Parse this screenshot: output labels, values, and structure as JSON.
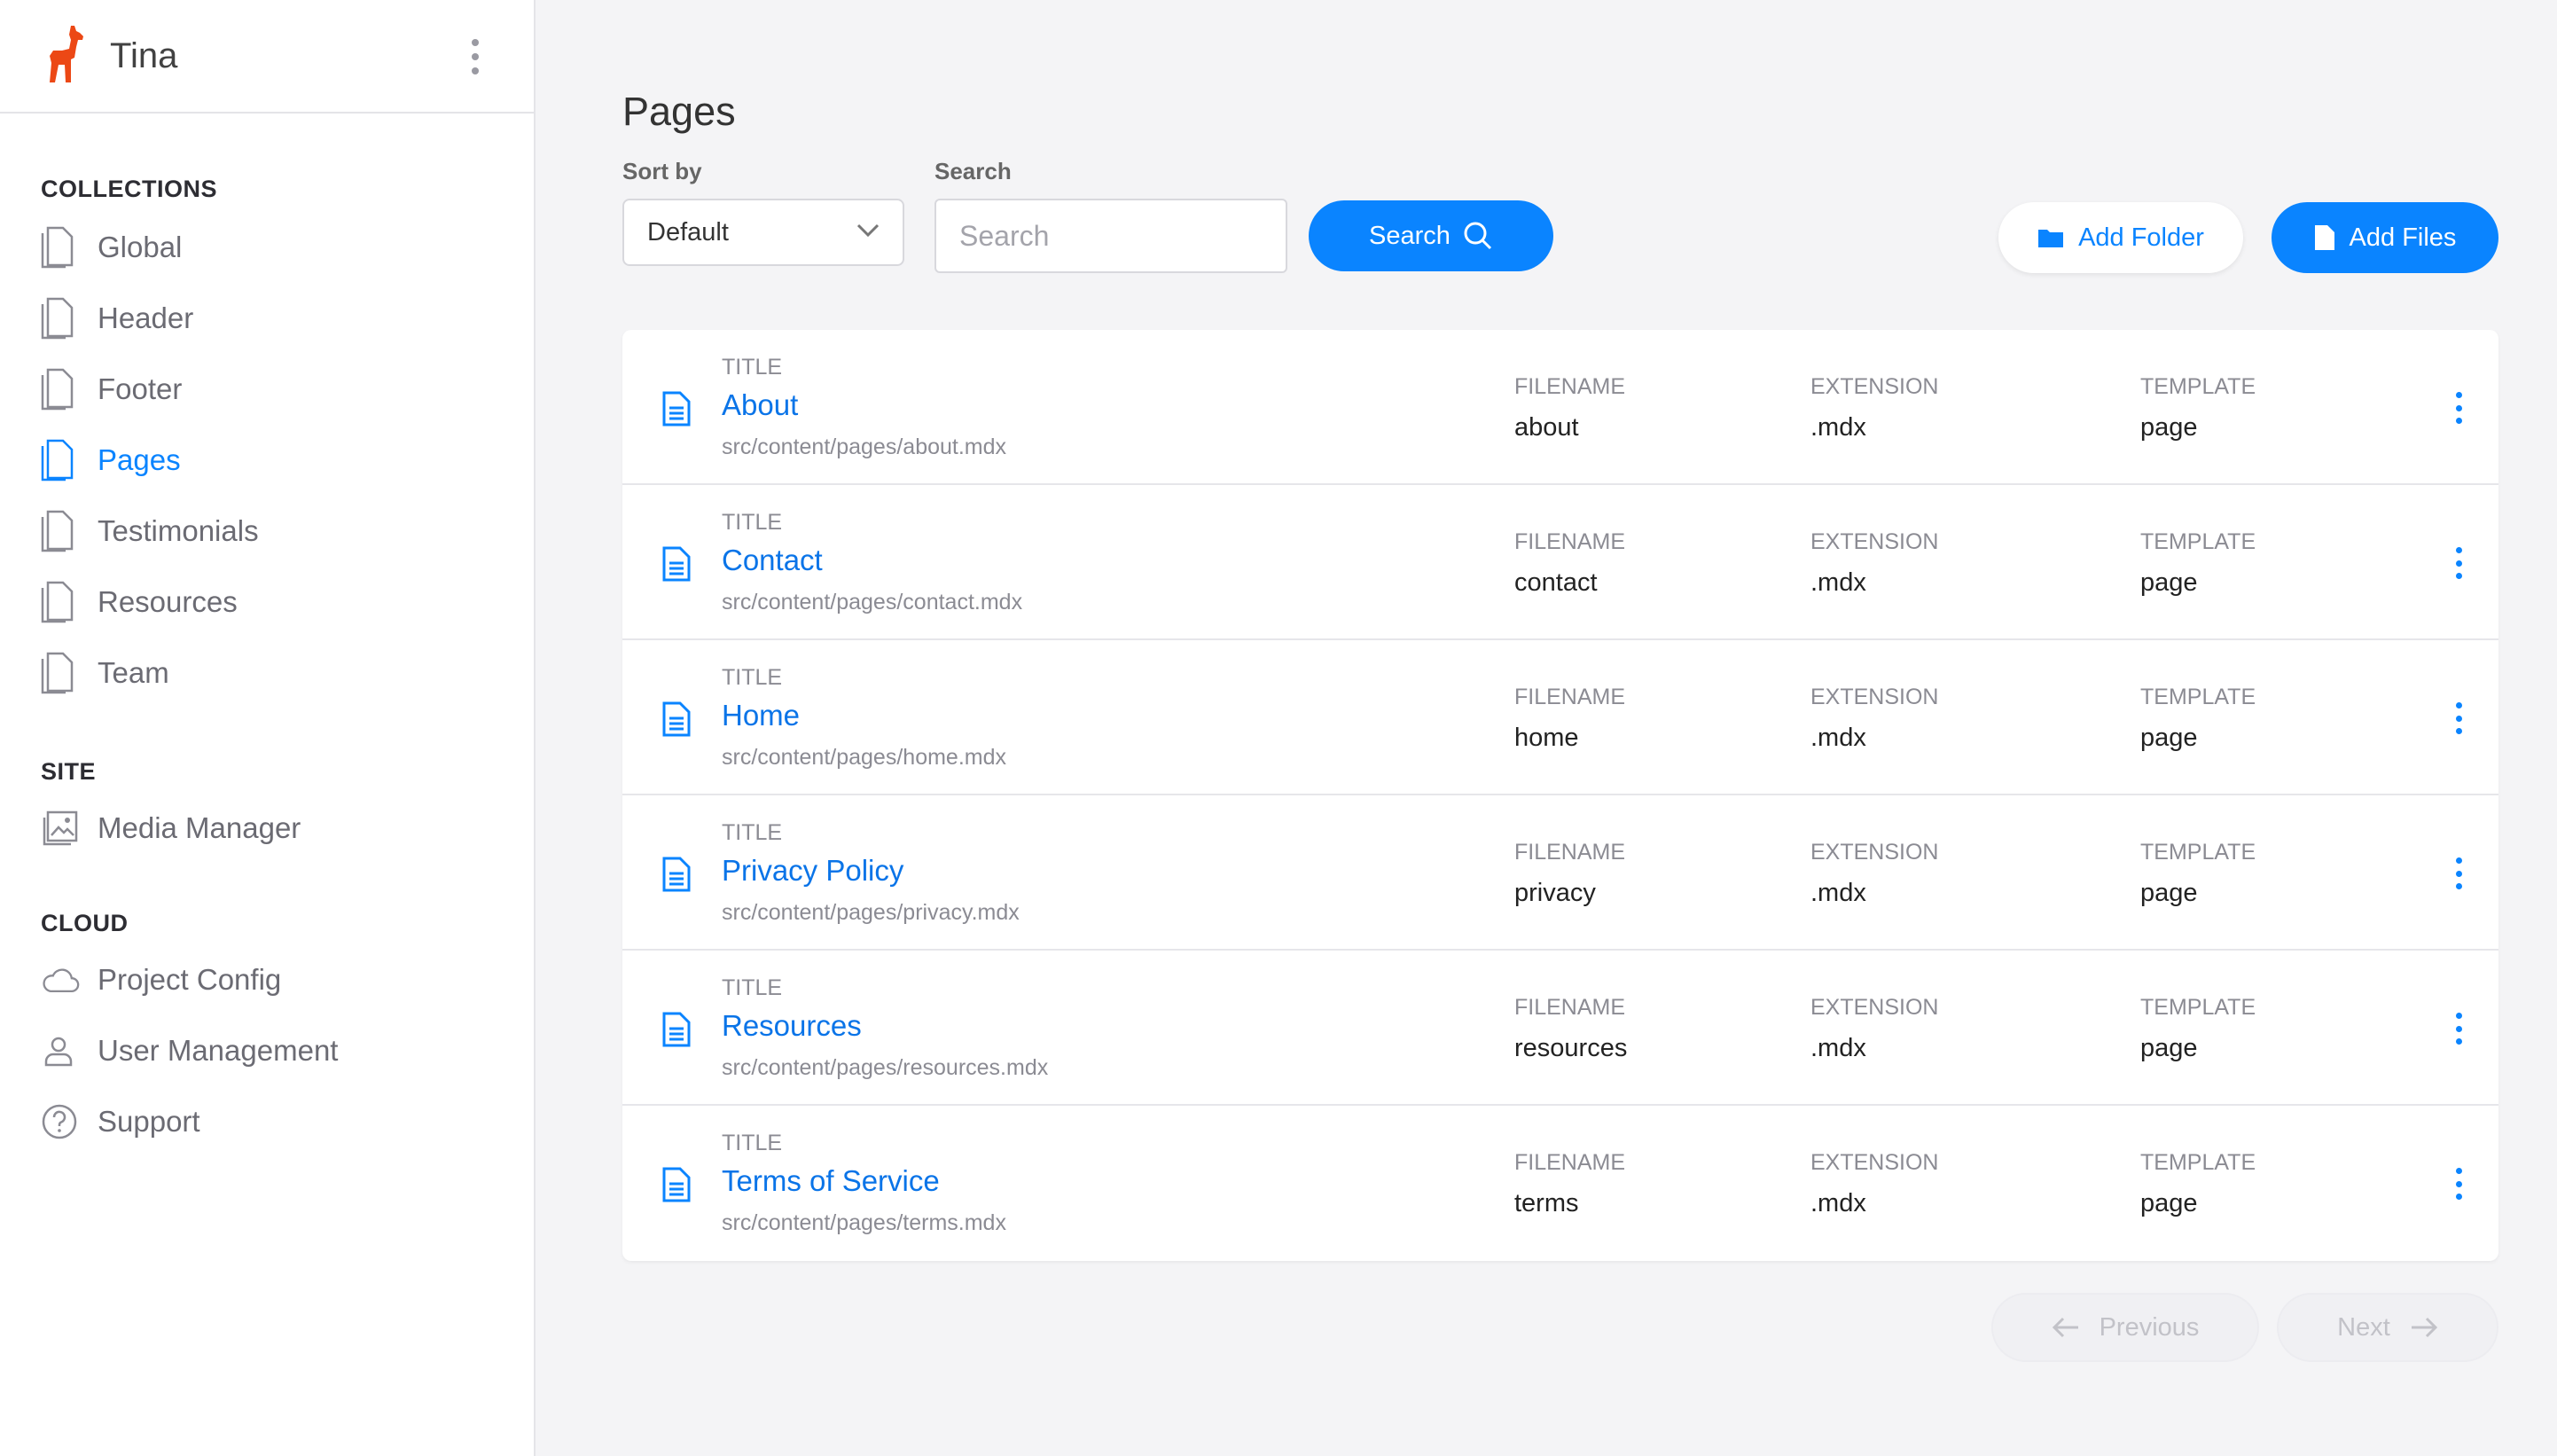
{
  "app": {
    "title": "Tina"
  },
  "sidebar": {
    "collections_label": "COLLECTIONS",
    "collections": [
      {
        "label": "Global",
        "active": false
      },
      {
        "label": "Header",
        "active": false
      },
      {
        "label": "Footer",
        "active": false
      },
      {
        "label": "Pages",
        "active": true
      },
      {
        "label": "Testimonials",
        "active": false
      },
      {
        "label": "Resources",
        "active": false
      },
      {
        "label": "Team",
        "active": false
      }
    ],
    "site_label": "SITE",
    "site": [
      {
        "label": "Media Manager",
        "icon": "image-icon"
      }
    ],
    "cloud_label": "CLOUD",
    "cloud": [
      {
        "label": "Project Config",
        "icon": "cloud-icon"
      },
      {
        "label": "User Management",
        "icon": "user-icon"
      },
      {
        "label": "Support",
        "icon": "help-icon"
      }
    ]
  },
  "main": {
    "page_title": "Pages",
    "sort_label": "Sort by",
    "sort_value": "Default",
    "search_label": "Search",
    "search_placeholder": "Search",
    "search_button": "Search",
    "add_folder": "Add Folder",
    "add_files": "Add Files",
    "columns": {
      "title": "TITLE",
      "filename": "FILENAME",
      "extension": "EXTENSION",
      "template": "TEMPLATE"
    },
    "rows": [
      {
        "title": "About",
        "path": "src/content/pages/about.mdx",
        "filename": "about",
        "extension": ".mdx",
        "template": "page"
      },
      {
        "title": "Contact",
        "path": "src/content/pages/contact.mdx",
        "filename": "contact",
        "extension": ".mdx",
        "template": "page"
      },
      {
        "title": "Home",
        "path": "src/content/pages/home.mdx",
        "filename": "home",
        "extension": ".mdx",
        "template": "page"
      },
      {
        "title": "Privacy Policy",
        "path": "src/content/pages/privacy.mdx",
        "filename": "privacy",
        "extension": ".mdx",
        "template": "page"
      },
      {
        "title": "Resources",
        "path": "src/content/pages/resources.mdx",
        "filename": "resources",
        "extension": ".mdx",
        "template": "page"
      },
      {
        "title": "Terms of Service",
        "path": "src/content/pages/terms.mdx",
        "filename": "terms",
        "extension": ".mdx",
        "template": "page"
      }
    ],
    "pagination": {
      "previous": "Previous",
      "next": "Next"
    }
  },
  "colors": {
    "accent": "#0a84ff",
    "brand": "#ec4815"
  }
}
